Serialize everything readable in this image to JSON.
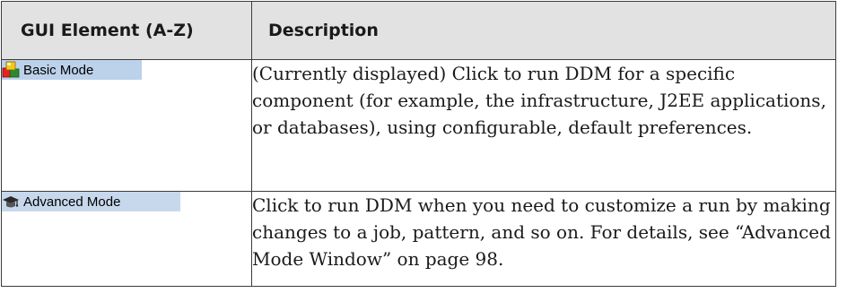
{
  "table": {
    "headers": {
      "element": "GUI Element (A-Z)",
      "description": "Description"
    },
    "rows": [
      {
        "element_label": "Basic Mode",
        "icon": "colored-blocks-icon",
        "description": "(Currently displayed) Click to run DDM for a specific component (for example, the infrastructure, J2EE applications, or databases), using configurable, default preferences."
      },
      {
        "element_label": "Advanced Mode",
        "icon": "graduation-cap-icon",
        "description": "Click to run DDM when you need to customize a run by making changes to a job, pattern, and so on. For details, see “Advanced Mode Window” on page 98."
      }
    ]
  },
  "colors": {
    "header_bg": "#e2e2e2",
    "chip_highlight": "#bcd1ea",
    "border": "#3c3c3c"
  }
}
